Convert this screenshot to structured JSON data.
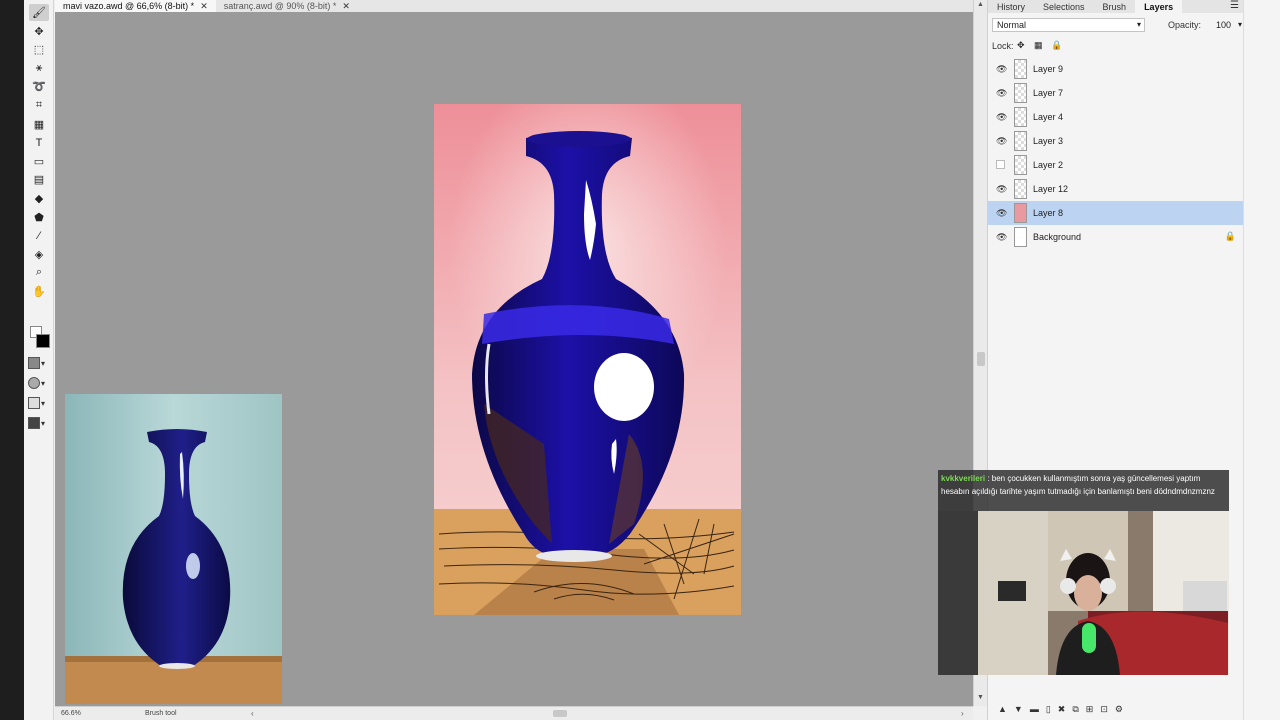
{
  "tabs": [
    {
      "label": "mavi vazo.awd @ 66,6% (8-bit) *",
      "active": true
    },
    {
      "label": "satranç.awd @ 90% (8-bit) *",
      "active": false
    }
  ],
  "tools": [
    {
      "icon": "brush-icon",
      "glyph": "🖌",
      "active": true
    },
    {
      "icon": "move-icon",
      "glyph": "✥"
    },
    {
      "icon": "marquee-icon",
      "glyph": "⬚"
    },
    {
      "icon": "magic-wand-icon",
      "glyph": "⚹"
    },
    {
      "icon": "lasso-icon",
      "glyph": "➰"
    },
    {
      "icon": "crop-icon",
      "glyph": "⌗"
    },
    {
      "icon": "grid-icon",
      "glyph": "▦"
    },
    {
      "icon": "text-icon",
      "glyph": "T"
    },
    {
      "icon": "rectangle-icon",
      "glyph": "▭"
    },
    {
      "icon": "gradient-icon",
      "glyph": "▤"
    },
    {
      "icon": "eraser-icon",
      "glyph": "◆"
    },
    {
      "icon": "stamp-icon",
      "glyph": "⬟"
    },
    {
      "icon": "eyedropper-icon",
      "glyph": "⁄"
    },
    {
      "icon": "fill-bucket-icon",
      "glyph": "◈"
    },
    {
      "icon": "zoom-icon",
      "glyph": "⌕"
    },
    {
      "icon": "hand-icon",
      "glyph": "✋"
    }
  ],
  "statusbar": {
    "zoom": "66.6%",
    "tool": "Brush tool"
  },
  "panel": {
    "tabs": [
      "History",
      "Selections",
      "Brush",
      "Layers"
    ],
    "active_tab": "Layers",
    "blend_mode": "Normal",
    "opacity_label": "Opacity:",
    "opacity_value": "100",
    "lock_label": "Lock:",
    "layers": [
      {
        "name": "Layer 9",
        "visible": true,
        "selected": false,
        "thumb": "transparent"
      },
      {
        "name": "Layer 7",
        "visible": true,
        "selected": false,
        "thumb": "transparent"
      },
      {
        "name": "Layer 4",
        "visible": true,
        "selected": false,
        "thumb": "transparent"
      },
      {
        "name": "Layer 3",
        "visible": true,
        "selected": false,
        "thumb": "transparent"
      },
      {
        "name": "Layer 2",
        "visible": false,
        "selected": false,
        "thumb": "transparent"
      },
      {
        "name": "Layer 12",
        "visible": true,
        "selected": false,
        "thumb": "transparent"
      },
      {
        "name": "Layer 8",
        "visible": true,
        "selected": true,
        "thumb": "pink"
      },
      {
        "name": "Background",
        "visible": true,
        "selected": false,
        "thumb": "white",
        "locked": true
      }
    ]
  },
  "chat": {
    "username": "kvkkverileri",
    "separator": ":",
    "message": "ben çocukken kullanmıştım sonra yaş güncellemesi yaptım hesabın açıldığı tarihte yaşım tutmadığı için banlamıştı beni dödndmdnzmznz"
  },
  "colors": {
    "selection": "#bcd4f2",
    "canvas_bg": "#9a9a9a",
    "chat_user": "#7ed957"
  }
}
